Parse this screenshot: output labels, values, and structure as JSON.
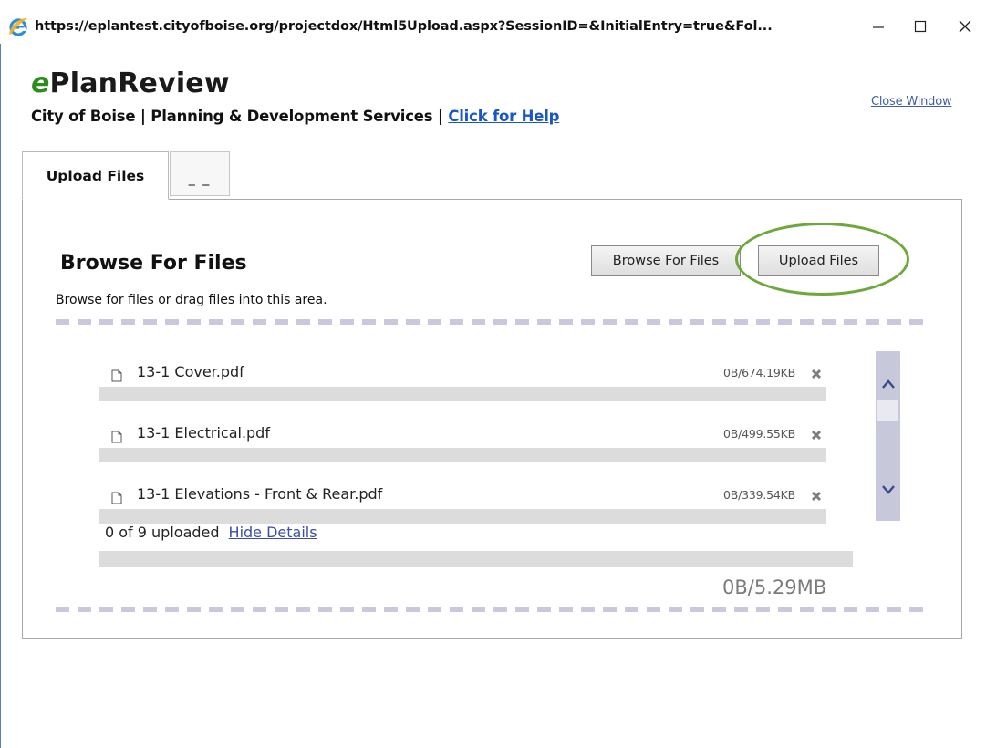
{
  "window": {
    "title": "https://eplantest.cityofboise.org/projectdox/Html5Upload.aspx?SessionID=&InitialEntry=true&Fol...",
    "icon": "ie-icon",
    "controls": {
      "minimize": "minimize-icon",
      "maximize": "maximize-icon",
      "close": "close-icon"
    }
  },
  "header": {
    "brand_prefix": "e",
    "brand_rest": "PlanReview",
    "org_text": "City of Boise | Planning & Development Services | ",
    "help_link": "Click for Help",
    "close_window": "Close Window",
    "brand_color": "#2e8b1f",
    "link_color": "#1a56c4"
  },
  "tabs": [
    {
      "label": "Upload Files",
      "active": true
    },
    {
      "label": "_ _",
      "active": false
    }
  ],
  "upload": {
    "title": "Browse For Files",
    "hint": "Browse for files or drag files into this area.",
    "browse_button": "Browse For Files",
    "upload_button": "Upload Files",
    "highlight_color": "#6ea83b",
    "files": [
      {
        "name": "13-1 Cover.pdf",
        "size": "0B/674.19KB",
        "progress": 0
      },
      {
        "name": "13-1 Electrical.pdf",
        "size": "0B/499.55KB",
        "progress": 0
      },
      {
        "name": "13-1 Elevations - Front & Rear.pdf",
        "size": "0B/339.54KB",
        "progress": 0
      }
    ],
    "summary": "0 of 9 uploaded",
    "hide_details": "Hide Details",
    "total_size": "0B/5.29MB",
    "total_progress": 0
  }
}
